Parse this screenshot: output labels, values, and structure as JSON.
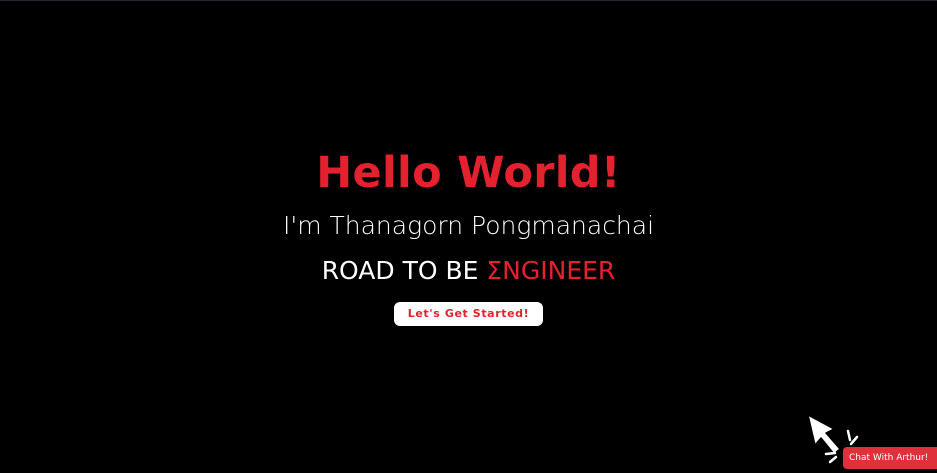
{
  "colors": {
    "background": "#000000",
    "accent": "#e3212f",
    "text": "#ffffff",
    "chat_button_bg": "#e0303c"
  },
  "hero": {
    "title": "Hello World!",
    "subtitle": "I'm Thanagorn Pongmanachai",
    "tagline_prefix": "ROAD TO BE ",
    "tagline_accent": "ΣNGINEER",
    "cta_label": "Let's Get Started!"
  },
  "chat_widget": {
    "label": "Chat With Arthur!",
    "icon": "pointer-hand-icon"
  }
}
